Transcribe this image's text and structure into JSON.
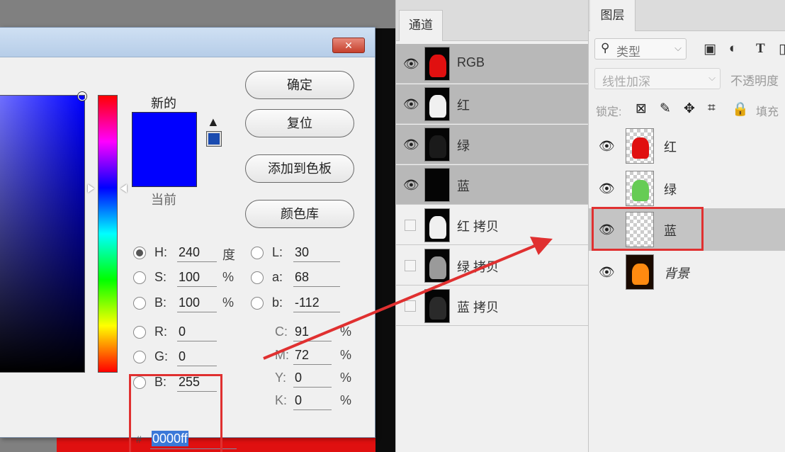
{
  "picker": {
    "label_new": "新的",
    "label_current": "当前",
    "gamut_warning_icon": "warning-triangle-icon",
    "new_color": "#0000ff",
    "current_color": "#0000ff",
    "buttons": {
      "ok": "确定",
      "reset": "复位",
      "add_to_swatches": "添加到色板",
      "color_libraries": "颜色库"
    },
    "hsb": {
      "h": {
        "label": "H:",
        "value": "240",
        "unit": "度"
      },
      "s": {
        "label": "S:",
        "value": "100",
        "unit": "%"
      },
      "b": {
        "label": "B:",
        "value": "100",
        "unit": "%"
      }
    },
    "lab": {
      "l": {
        "label": "L:",
        "value": "30"
      },
      "a": {
        "label": "a:",
        "value": "68"
      },
      "b": {
        "label": "b:",
        "value": "-112"
      }
    },
    "rgb": {
      "r": {
        "label": "R:",
        "value": "0"
      },
      "g": {
        "label": "G:",
        "value": "0"
      },
      "b": {
        "label": "B:",
        "value": "255"
      }
    },
    "cmyk": {
      "c": {
        "label": "C:",
        "value": "91",
        "unit": "%"
      },
      "m": {
        "label": "M:",
        "value": "72",
        "unit": "%"
      },
      "y": {
        "label": "Y:",
        "value": "0",
        "unit": "%"
      },
      "k": {
        "label": "K:",
        "value": "0",
        "unit": "%"
      }
    },
    "hex_label": "#",
    "hex_value": "0000ff"
  },
  "channels": {
    "tab": "通道",
    "rows": [
      {
        "name": "RGB",
        "visible": true
      },
      {
        "name": "红",
        "visible": true
      },
      {
        "name": "绿",
        "visible": true
      },
      {
        "name": "蓝",
        "visible": true
      },
      {
        "name": "红 拷贝",
        "visible": false
      },
      {
        "name": "绿 拷贝",
        "visible": false
      },
      {
        "name": "蓝 拷贝",
        "visible": false
      }
    ]
  },
  "layers": {
    "tab": "图层",
    "filter_label": "类型",
    "blend_mode": "线性加深",
    "opacity_label": "不透明度",
    "lock_label": "锁定:",
    "fill_label": "填充",
    "rows": [
      {
        "name": "红"
      },
      {
        "name": "绿"
      },
      {
        "name": "蓝"
      },
      {
        "name": "背景"
      }
    ]
  },
  "colors": {
    "highlight": "#e03030",
    "blue": "#0000ff",
    "selected_row": "#b8b8b8"
  }
}
